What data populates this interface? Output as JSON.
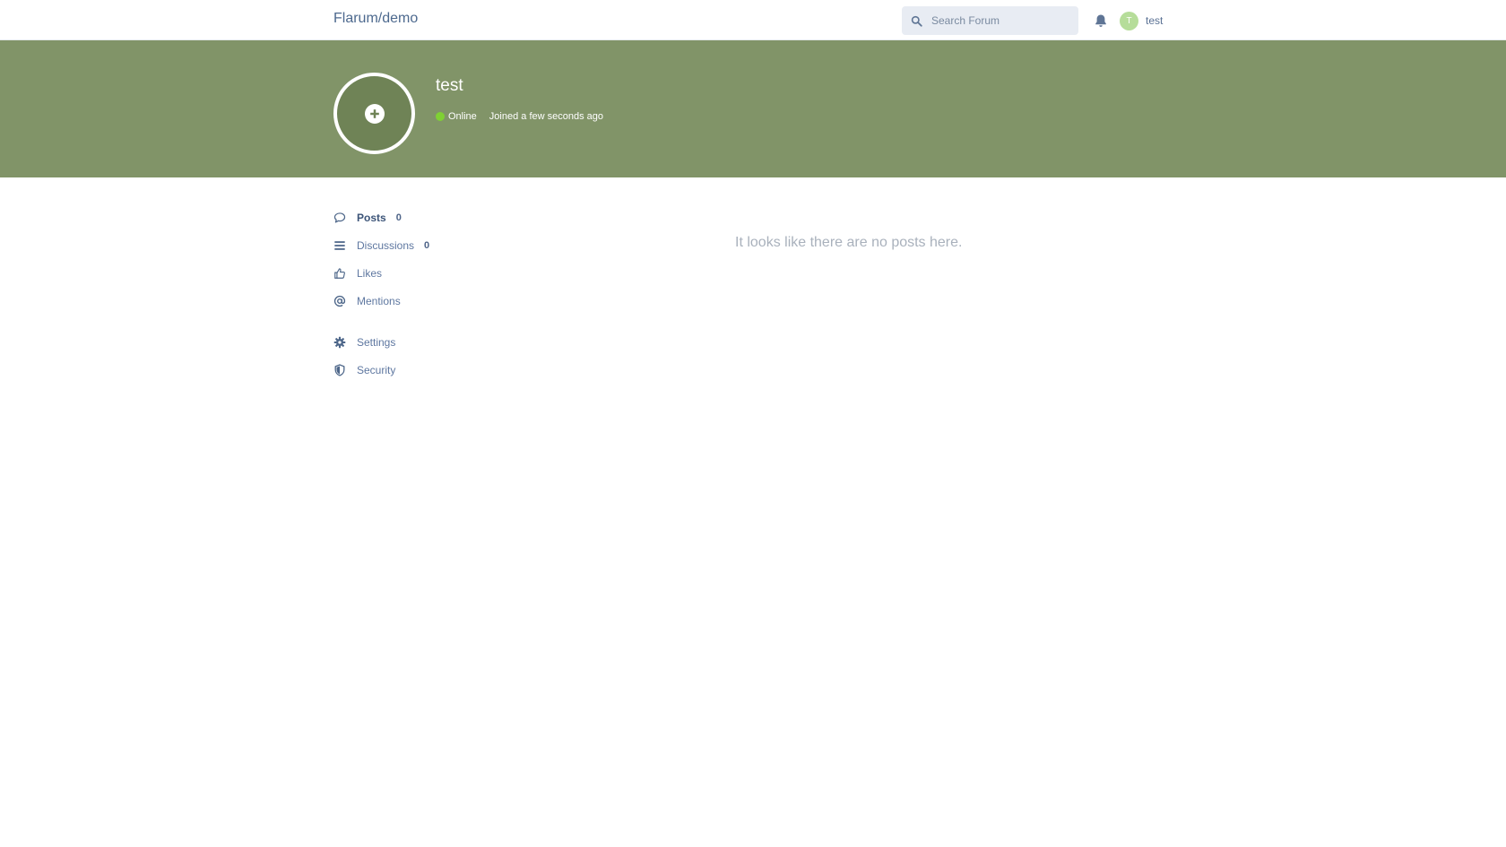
{
  "header": {
    "brand": "Flarum/demo",
    "search_placeholder": "Search Forum",
    "user_initial": "T",
    "username": "test"
  },
  "hero": {
    "username": "test",
    "status": "Online",
    "joined": "Joined a few seconds ago",
    "background_color": "#819468",
    "online_color": "#7fd133"
  },
  "nav": {
    "items": [
      {
        "label": "Posts",
        "count": "0",
        "icon": "comment-icon"
      },
      {
        "label": "Discussions",
        "count": "0",
        "icon": "list-icon"
      },
      {
        "label": "Likes",
        "icon": "thumbs-up-icon"
      },
      {
        "label": "Mentions",
        "icon": "at-icon"
      }
    ],
    "secondary": [
      {
        "label": "Settings",
        "icon": "gear-icon"
      },
      {
        "label": "Security",
        "icon": "shield-icon"
      }
    ]
  },
  "main": {
    "empty_text": "It looks like there are no posts here."
  }
}
